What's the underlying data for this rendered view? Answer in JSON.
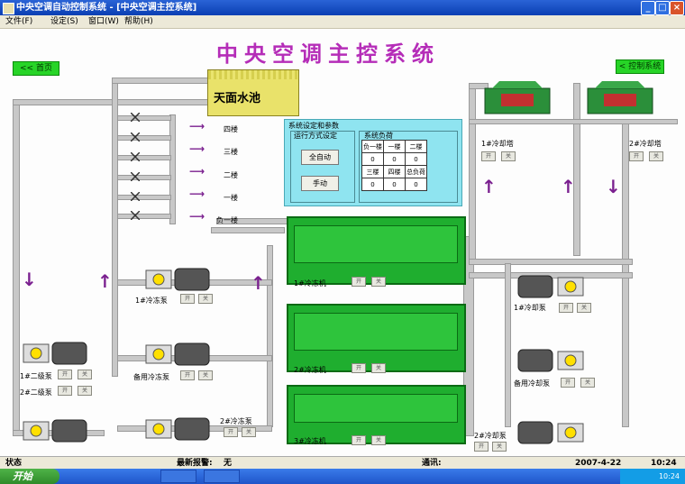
{
  "window": {
    "title": "中央空调自动控制系统 - [中央空调主控系统]"
  },
  "menu": [
    "文件(F)",
    "设定(S)",
    "窗口(W)",
    "帮助(H)"
  ],
  "main_title": "中央空调主控系统",
  "nav": {
    "home": "<< 首页",
    "control": "< 控制系统"
  },
  "tank": {
    "name": "天面水池"
  },
  "floors": [
    "四楼",
    "三楼",
    "二楼",
    "一楼",
    "负一楼"
  ],
  "panel": {
    "title": "系统设定和参数",
    "mode_title": "运行方式设定",
    "auto_btn": "全自动",
    "manual_btn": "手动",
    "load_title": "系统负荷",
    "load_table": [
      [
        "负一楼",
        "一楼",
        "二楼"
      ],
      [
        "0",
        "0",
        "0"
      ],
      [
        "三楼",
        "四楼",
        "总负荷"
      ],
      [
        "0",
        "0",
        "0"
      ]
    ]
  },
  "chillers": [
    "1#冷冻机",
    "2#冷冻机",
    "3#冷冻机"
  ],
  "chiller_buttons": {
    "on": "开",
    "off": "关"
  },
  "chilled_pumps": [
    "1#冷冻泵",
    "备用冷冻泵",
    "2#冷冻泵"
  ],
  "secondary_pumps": [
    "1#二级泵",
    "2#二级泵"
  ],
  "cooling_pumps": [
    "1#冷却泵",
    "备用冷却泵",
    "2#冷却泵"
  ],
  "towers": [
    "1#冷却塔",
    "2#冷却塔"
  ],
  "status": {
    "state_label": "状态",
    "alarm_label": "最新报警:",
    "alarm_value": "无",
    "comm_label": "通讯:",
    "date": "2007-4-22",
    "time": "10:24"
  },
  "taskbar": {
    "start": "开始",
    "clock": "10:24"
  },
  "colors": {
    "title": "#b52db8",
    "equipment": "#1fae2f",
    "panel": "#8fe4f0",
    "arrow": "#7a1f8f"
  }
}
